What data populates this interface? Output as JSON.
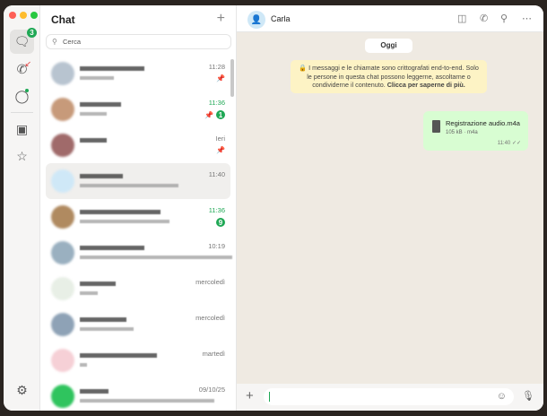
{
  "window": {
    "traffic_lights": [
      "#fe5f57",
      "#febc2e",
      "#28c840"
    ]
  },
  "rail": {
    "items": [
      {
        "icon": "chats-icon",
        "badge": "3"
      },
      {
        "icon": "calls-icon"
      },
      {
        "icon": "status-icon"
      },
      {
        "icon": "archive-icon"
      },
      {
        "icon": "starred-icon"
      },
      {
        "icon": "settings-icon"
      }
    ]
  },
  "list": {
    "title": "Chat",
    "search_placeholder": "Cerca",
    "rows": [
      {
        "time": "11:28",
        "pinned": true,
        "avatar": "#b8c4d0"
      },
      {
        "time": "11:36",
        "unread": true,
        "pinned": true,
        "badge": "1",
        "avatar": "#c79a7a"
      },
      {
        "time": "Ieri",
        "pinned": true,
        "avatar": "#a06a6a"
      },
      {
        "time": "11:40",
        "selected": true,
        "avatar": "#cfe8f7"
      },
      {
        "time": "11:36",
        "unread": true,
        "badge": "9",
        "avatar": "#b08a60"
      },
      {
        "time": "10:19",
        "avatar": "#9ab0c0"
      },
      {
        "time": "mercoledì",
        "avatar": "#e8efe6"
      },
      {
        "time": "mercoledì",
        "avatar": "#8ea2b6"
      },
      {
        "time": "martedì",
        "avatar": "#f6d0d6"
      },
      {
        "time": "09/10/25",
        "avatar": "#2fc45e"
      }
    ]
  },
  "chat": {
    "contact": "Carla",
    "day": "Oggi",
    "encryption_text": "I messaggi e le chiamate sono crittografati end-to-end. Solo le persone in questa chat possono leggerne, ascoltarne o condividerne il contenuto.",
    "encryption_link": "Clicca per saperne di più.",
    "message": {
      "file_name": "Registrazione audio.m4a",
      "file_info": "105 kB · m4a",
      "time": "11:40",
      "status": "read"
    },
    "accent": "#1fa855"
  }
}
